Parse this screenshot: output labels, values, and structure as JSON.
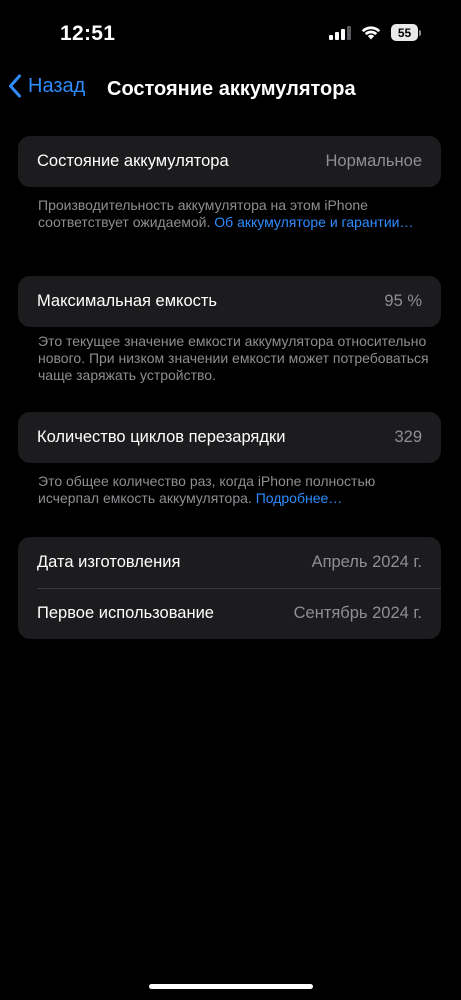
{
  "status_bar": {
    "time": "12:51",
    "battery_level": "55",
    "icons": [
      "signal-icon",
      "wifi-icon",
      "battery-icon"
    ]
  },
  "nav": {
    "back_label": "Назад",
    "title": "Состояние аккумулятора"
  },
  "battery_health": {
    "label": "Состояние аккумулятора",
    "value": "Нормальное",
    "footer_text": "Производительность аккумулятора на этом iPhone соответствует ожидаемой. ",
    "footer_link": "Об аккумуляторе и гарантии…"
  },
  "max_capacity": {
    "label": "Максимальная емкость",
    "value": "95 %",
    "footer_text": "Это текущее значение емкости аккумулятора относительно нового. При низком значении емкости может потребоваться чаще заряжать устройство."
  },
  "cycle_count": {
    "label": "Количество циклов перезарядки",
    "value": "329",
    "footer_text": "Это общее количество раз, когда iPhone полностью исчерпал емкость аккумулятора. ",
    "footer_link": "Подробнее…"
  },
  "dates": {
    "manufacture_label": "Дата изготовления",
    "manufacture_value": "Апрель 2024 г.",
    "first_use_label": "Первое использование",
    "first_use_value": "Сентябрь 2024 г."
  },
  "colors": {
    "background": "#000000",
    "card": "#1c1c1e",
    "accent": "#2e8cff",
    "secondary_text": "#8e8e93"
  }
}
